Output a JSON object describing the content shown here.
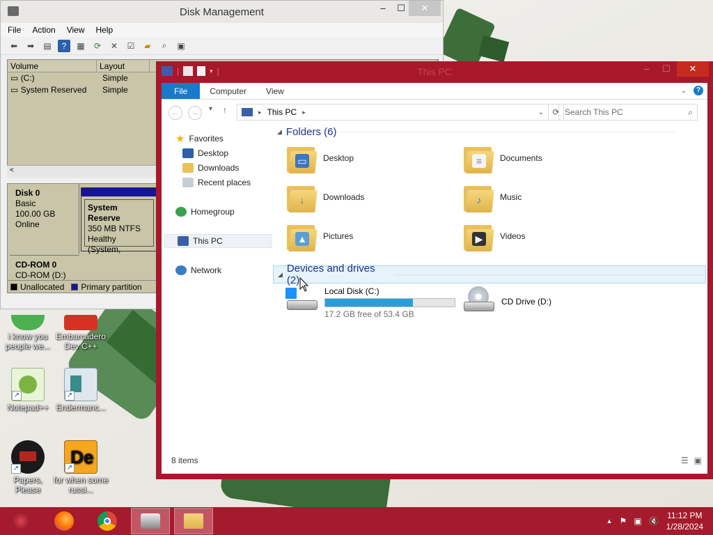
{
  "disk_mgmt": {
    "title": "Disk Management",
    "menu": [
      "File",
      "Action",
      "View",
      "Help"
    ],
    "columns": [
      "Volume",
      "Layout"
    ],
    "rows": [
      {
        "volume": "(C:)",
        "layout": "Simple"
      },
      {
        "volume": "System Reserved",
        "layout": "Simple"
      }
    ],
    "disk0": {
      "name": "Disk 0",
      "type": "Basic",
      "size": "100.00 GB",
      "status": "Online"
    },
    "partition": {
      "name": "System Reserve",
      "size": "350 MB NTFS",
      "status": "Healthy (System,"
    },
    "cdrom": {
      "name": "CD-ROM 0",
      "drive": "CD-ROM (D:)"
    },
    "legend": {
      "unallocated": "Unallocated",
      "primary": "Primary partition"
    }
  },
  "explorer": {
    "title": "This PC",
    "ribbon_tabs": [
      "File",
      "Computer",
      "View"
    ],
    "address": "This PC",
    "search_placeholder": "Search This PC",
    "nav": {
      "favorites": "Favorites",
      "desktop": "Desktop",
      "downloads": "Downloads",
      "recent": "Recent places",
      "homegroup": "Homegroup",
      "thispc": "This PC",
      "network": "Network"
    },
    "folders_header": "Folders (6)",
    "folders": [
      "Desktop",
      "Documents",
      "Downloads",
      "Music",
      "Pictures",
      "Videos"
    ],
    "devices_header": "Devices and drives (2)",
    "local_disk": {
      "name": "Local Disk (C:)",
      "free": "17.2 GB free of 53.4 GB",
      "used_fraction": 0.68
    },
    "cd_drive": {
      "name": "CD Drive (D:)"
    },
    "status": "8 items"
  },
  "desktop_icons": [
    {
      "label": "i know you people we..."
    },
    {
      "label": "Embarcadero Dev C++"
    },
    {
      "label": "Notepad++"
    },
    {
      "label": "Endermanc..."
    },
    {
      "label": "Papers, Please"
    },
    {
      "label": "for when some russi..."
    }
  ],
  "taskbar": {
    "time": "11:12 PM",
    "date": "1/28/2024"
  },
  "colors": {
    "accent": "#1979ca",
    "taskbar": "#a51a2c",
    "window_border": "#a8182b",
    "progress": "#26a0da"
  }
}
